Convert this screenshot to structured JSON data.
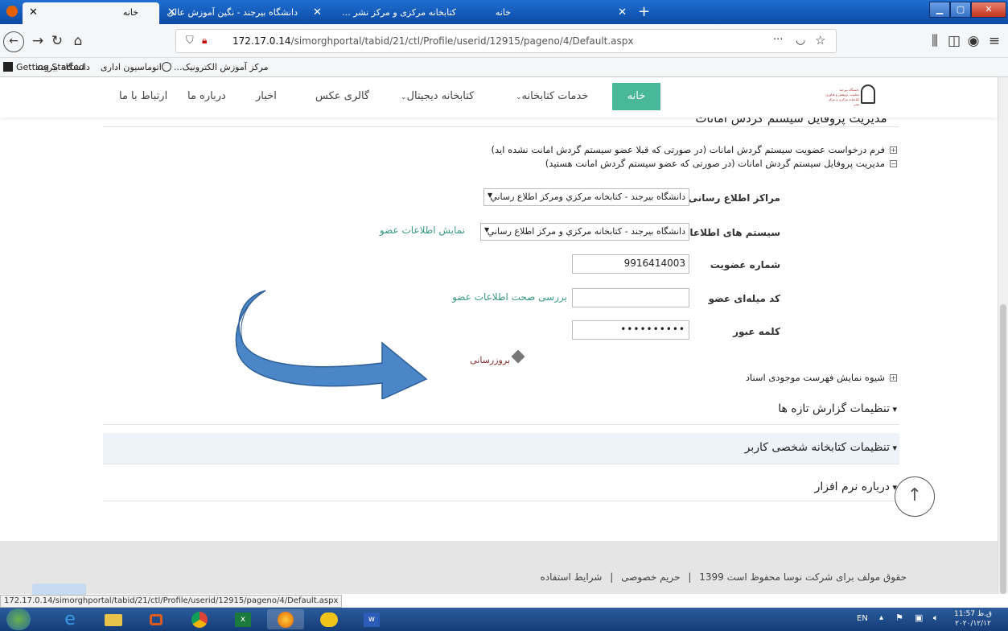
{
  "browser": {
    "tabs": [
      {
        "label": "خانه",
        "active": true
      },
      {
        "label": "دانشگاه بیرجند - نگین آموزش عالی ...",
        "active": false
      },
      {
        "label": "کتابخانه مرکزی و مرکز نشر ...",
        "active": false
      },
      {
        "label": "خانه",
        "active": false
      }
    ],
    "new_tab": "+",
    "url_host": "172.17.0.14",
    "url_path": "/simorghportal/tabid/21/ctl/Profile/userid/12915/pageno/4/Default.aspx",
    "url_more": "···",
    "bookmarks": [
      "مرکز آموزش الکترونیک...",
      "اتوماسیون اداری",
      "دانشگاه بیرجند",
      "Getting Started"
    ]
  },
  "site": {
    "menu": {
      "home": "خانه",
      "services": "خدمات کتابخانه",
      "digital": "کتابخانه دیجیتال",
      "gallery": "گالری عکس",
      "news": "اخبار",
      "about": "درباره ما",
      "contact": "ارتباط با ما"
    },
    "logo_text": [
      "دانشگاه بیرجند",
      "معاونت پژوهش و فناوری",
      "کتابخانه مرکزی و مرکز نشر"
    ]
  },
  "profile": {
    "section_title": "مدیریت پروفایل سیستم گردش امانات",
    "option_request": "فرم درخواست عضویت سیستم گردش امانات (در صورتی که قبلا عضو سیستم گردش امانت نشده اید)",
    "option_manage": "مدیریت پروفایل سیستم گردش امانات (در صورتی که عضو سیستم گردش امانت هستید)",
    "center_label": "مراکز اطلاع رسانی",
    "center_value": "دانشگاه بيرجند - کتابخانه مرکزي ومرکز اطلاع رساني",
    "system_label": "سیستم های اطلاعاتی",
    "system_value": "دانشگاه بيرجند - کتابخانه مرکزي و مرکز اطلاع رساني",
    "show_member_info": "نمایش اطلاعات عضو",
    "member_no_label": "شماره عضویت",
    "member_no_value": "9916414003",
    "code_label": "کد میله‌ای عضو",
    "code_value": "",
    "verify_link": "بررسی صحت اطلاعات عضو",
    "password_label": "کلمه عبور",
    "password_value": "••••••••••",
    "update_link": "بروزرسانی",
    "catalog_option": "شیوه نمایش فهرست موجودی اسناد"
  },
  "sections": {
    "new_reports": "تنظیمات گزارش تازه ها",
    "personal_library": "تنظیمات کتابخانه شخصی کاربر",
    "about_software": "درباره نرم افزار"
  },
  "footer": {
    "copyright": "حقوق مولف برای شرکت نوسا محفوظ است 1399",
    "sep": "|",
    "privacy": "حریم خصوصی",
    "terms": "شرایط استفاده"
  },
  "status_url": "172.17.0.14/simorghportal/tabid/21/ctl/Profile/userid/12915/pageno/4/Default.aspx",
  "tray": {
    "lang": "EN",
    "time": "11:57 ق.ظ",
    "date": "۲۰۲۰/۱۲/۱۲"
  },
  "colors": {
    "accent_green": "#49b79a",
    "arrow_blue": "#4a86c8",
    "taskbar": "#1d4a88"
  }
}
